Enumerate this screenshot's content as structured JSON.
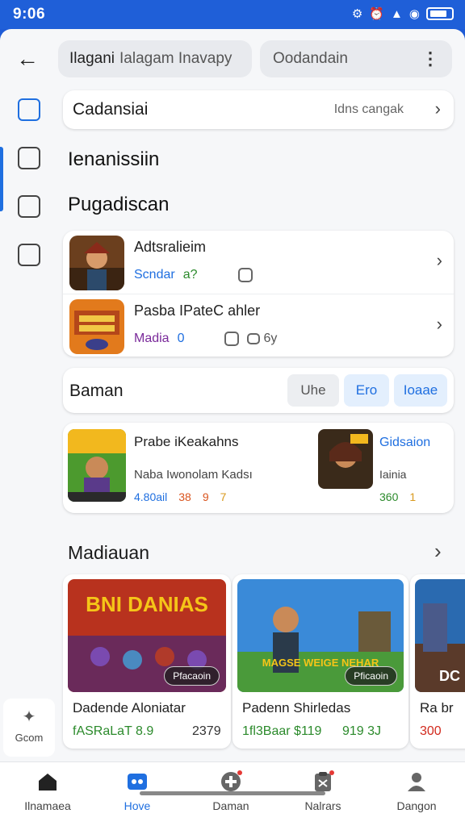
{
  "status": {
    "time": "9:06",
    "signal_icons": [
      "notification-icon",
      "alarm-icon",
      "signal-icon",
      "wifi-icon",
      "battery-icon"
    ]
  },
  "header": {
    "search_query": "Ilagani",
    "search_placeholder": "Ialagam Inavapy",
    "filter_label": "Oodandain"
  },
  "rail": {
    "bottom_label": "Gcom"
  },
  "category": {
    "label": "Cadansiai",
    "right_text": "Idns cangak"
  },
  "headings": {
    "h1": "Ienanissiin",
    "h2": "Pugadiscan"
  },
  "list": [
    {
      "name": "Adtsralieim",
      "tag": "Scndar",
      "tag_icon": "a?"
    },
    {
      "name": "Pasba IPateC ahler",
      "tag": "Madia",
      "tag_count": "0",
      "extra": "6y"
    }
  ],
  "filter_row": {
    "label": "Baman",
    "chips": [
      "Uhe",
      "Ero",
      "Ioaae"
    ]
  },
  "featured": {
    "left": {
      "name": "Prabe iKeakahns",
      "sub": "Naba Iwonolam Kadsı",
      "stats": [
        "4.80ail",
        "38",
        "9",
        "7"
      ]
    },
    "right": {
      "name": "Gidsaion",
      "sub": "Iainia",
      "stats": [
        "360",
        "1"
      ]
    }
  },
  "carousel": {
    "title": "Madiauan",
    "items": [
      {
        "art_title": "BNI DANIAS",
        "pill": "Pfacaoin",
        "title": "Dadende Aloniatar",
        "price": "fASRaLaT 8.9",
        "rating": "2379"
      },
      {
        "art_title": "MAGSE WEIGE NEHAR",
        "pill": "Pficaoin",
        "title": "Padenn Shirledas",
        "price": "1fl3Baar $119",
        "rating": "919  3J"
      },
      {
        "art_title": "DC",
        "pill": "",
        "title": "Ra br",
        "price": "300",
        "rating": ""
      }
    ]
  },
  "bottom_nav": [
    {
      "label": "Ilnamaea",
      "icon": "home-icon"
    },
    {
      "label": "Hove",
      "icon": "game-icon"
    },
    {
      "label": "Daman",
      "icon": "add-circle-icon"
    },
    {
      "label": "Nalrars",
      "icon": "clipboard-icon"
    },
    {
      "label": "Dangon",
      "icon": "person-icon"
    }
  ],
  "colors": {
    "accent": "#1f6fe0",
    "status_bar": "#1f5fd8",
    "price_green": "#2b8a2b"
  }
}
